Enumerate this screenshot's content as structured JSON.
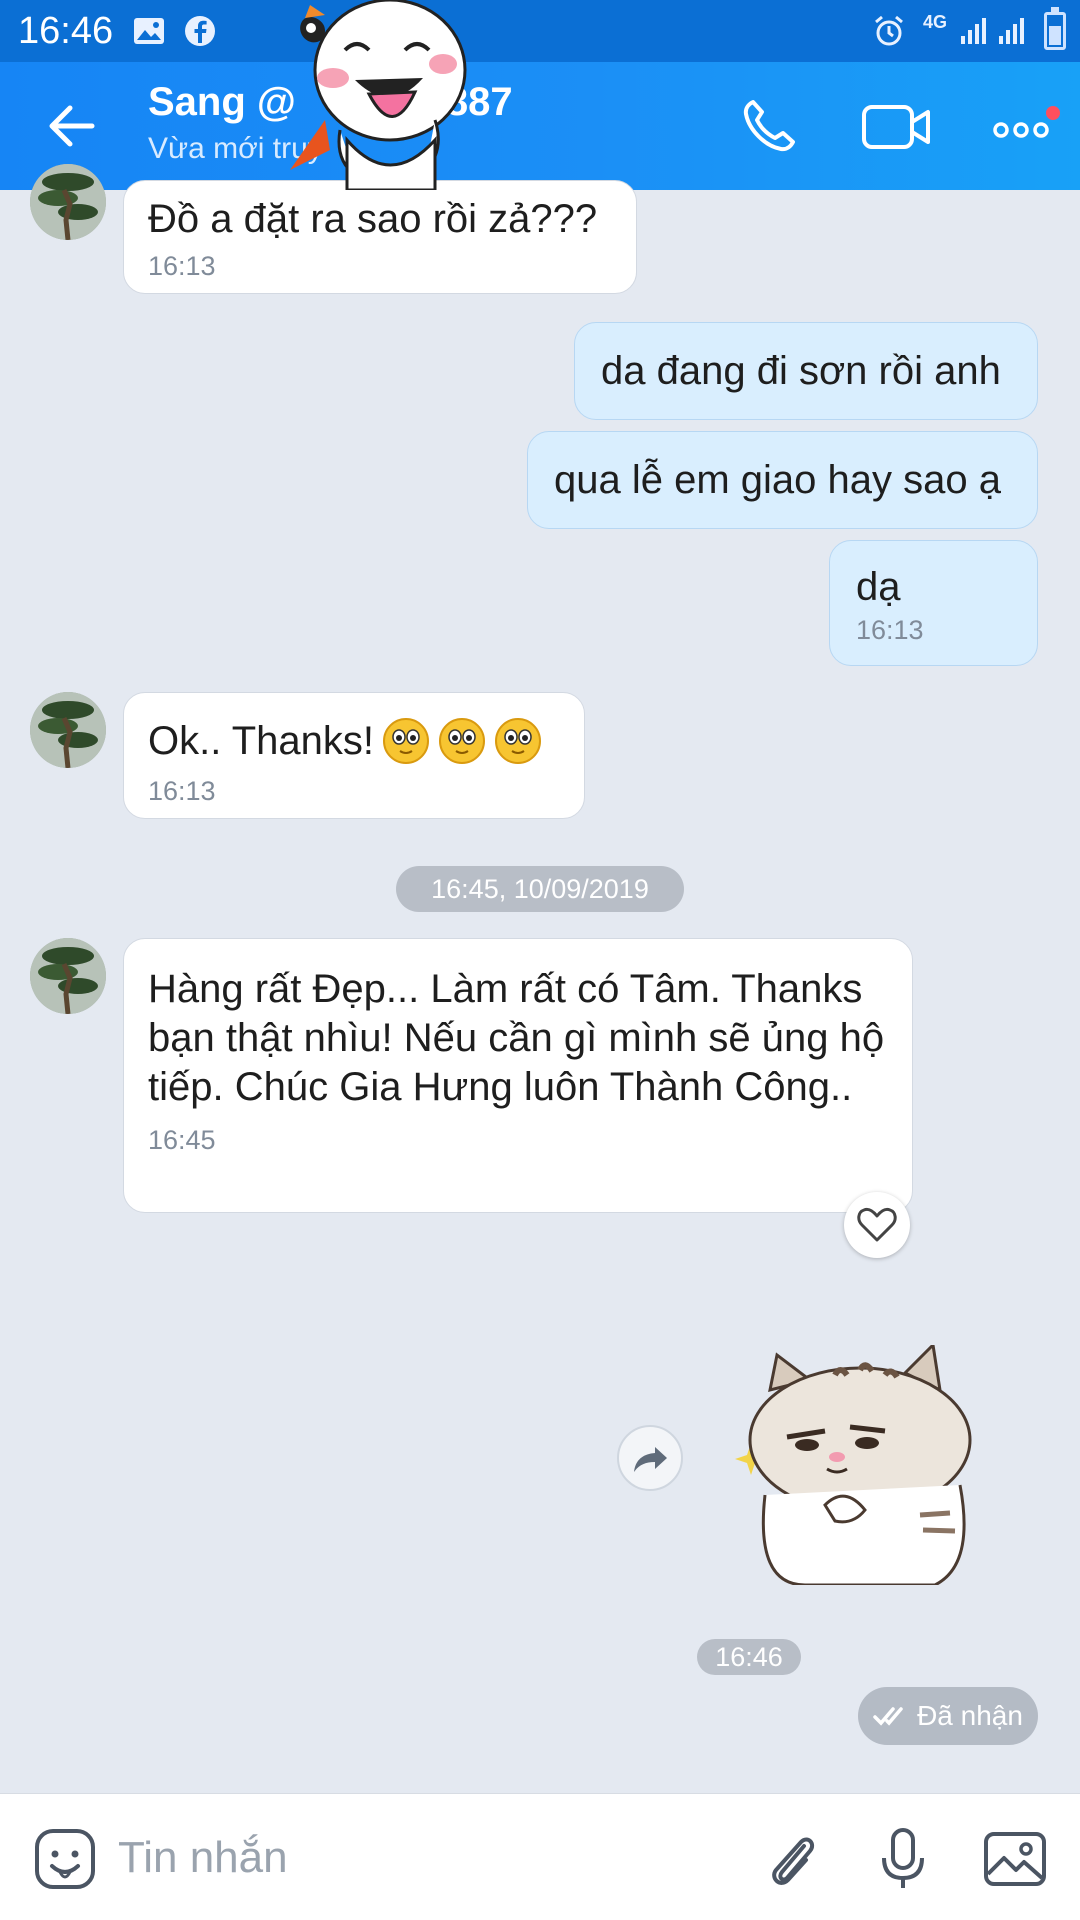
{
  "status_bar": {
    "time": "16:46",
    "network": "4G"
  },
  "header": {
    "name": "Sang @",
    "name_suffix": "887",
    "status": "Vừa mới truy"
  },
  "messages": [
    {
      "dir": "in",
      "text": "Đồ a đặt ra sao rồi zả???",
      "time": "16:13"
    },
    {
      "dir": "out",
      "text": "da đang đi sơn rồi anh"
    },
    {
      "dir": "out",
      "text": "qua lễ em giao hay sao ạ"
    },
    {
      "dir": "out",
      "text": "dạ",
      "time": "16:13"
    },
    {
      "dir": "in",
      "text": "Ok.. Thanks!",
      "time": "16:13"
    },
    {
      "dir": "in",
      "text": "Hàng rất Đẹp... Làm rất có Tâm. Thanks bạn thật nhìu! Nếu cần gì mình sẽ ủng hộ tiếp. Chúc Gia Hưng luôn Thành Công..",
      "time": "16:45"
    }
  ],
  "date_separator": "16:45, 10/09/2019",
  "sticker_time": "16:46",
  "delivery_status": "Đã nhận",
  "composer": {
    "placeholder": "Tin nhắn"
  },
  "colors": {
    "header": "#1685f5",
    "outgoing_bubble": "#d9eefe",
    "background": "#e4e9f1",
    "notification_dot": "#ff4f5e"
  }
}
